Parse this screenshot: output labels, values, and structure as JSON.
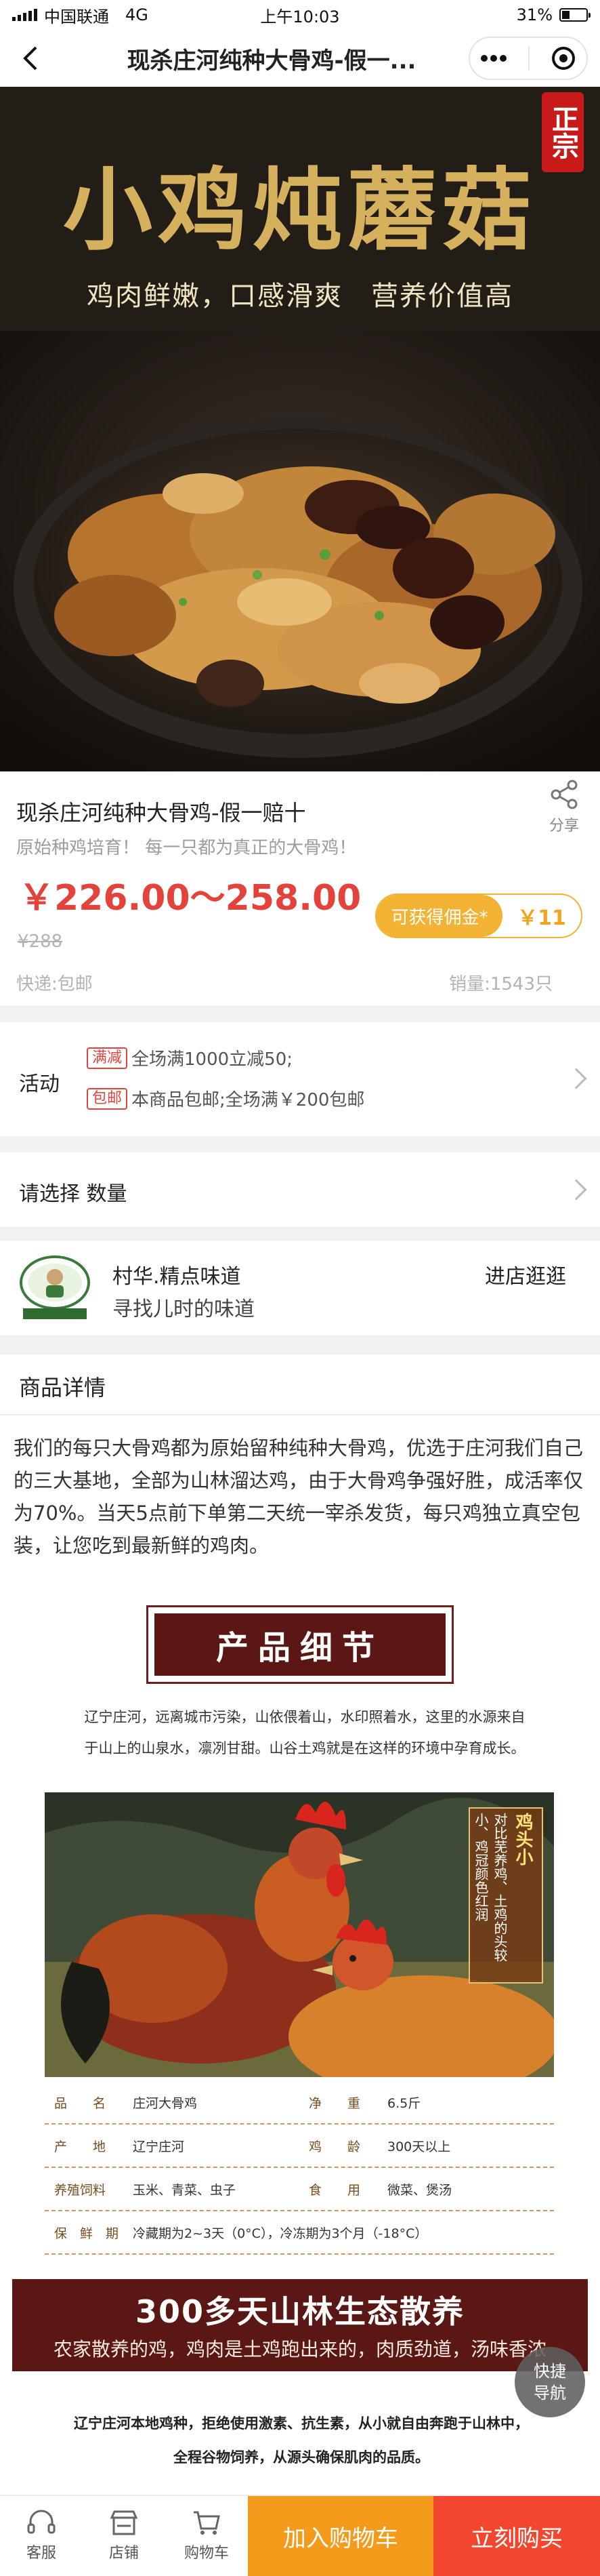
{
  "status_bar": {
    "carrier": "中国联通",
    "network": "4G",
    "time": "上午10:03",
    "battery": "31%",
    "battery_level": 0.31
  },
  "nav": {
    "title": "现杀庄河纯种大骨鸡-假一..."
  },
  "hero": {
    "title": "小鸡炖蘑菇",
    "subtitle": "鸡肉鲜嫩，口感滑爽　营养价值高",
    "badge": "正宗"
  },
  "product": {
    "name": "现杀庄河纯种大骨鸡-假一赔十",
    "share_label": "分享",
    "description": "原始种鸡培育！ 每一只都为真正的大骨鸡！",
    "price_range": "￥226.00～258.00",
    "commission_label": "可获得佣金*",
    "commission_value": "￥11",
    "original_price": "¥288",
    "shipping": "快递:包邮",
    "sales": "销量:1543只"
  },
  "activity": {
    "label": "活动",
    "items": [
      {
        "tag": "满减",
        "text": "全场满1000立减50;"
      },
      {
        "tag": "包邮",
        "text": "本商品包邮;全场满￥200包邮"
      }
    ]
  },
  "select": {
    "label": "请选择 数量"
  },
  "shop": {
    "name": "村华.精点味道",
    "slogan": "寻找儿时的味道",
    "enter_label": "进店逛逛",
    "logo_text": "Real Flavor Rustic"
  },
  "detail": {
    "title": "商品详情",
    "intro": "我们的每只大骨鸡都为原始留种纯种大骨鸡，优选于庄河我们自己的三大基地，全部为山林溜达鸡，由于大骨鸡争强好胜，成活率仅为70%。当天5点前下单第二天统一宰杀发货，每只鸡独立真空包装，让您吃到最新鲜的鸡肉。"
  },
  "poster": {
    "title": "产品细节",
    "text_line1": "辽宁庄河，远离城市污染，山依偎着山，水印照着水，这里的水源来自",
    "text_line2": "于山上的山泉水，凛冽甘甜。山谷土鸡就是在这样的环境中孕育成长。",
    "callout": {
      "head": "鸡头小",
      "col1": "对比芜养鸡、土鸡的头较",
      "col2": "小、鸡冠颜色红润"
    },
    "specs": [
      [
        {
          "k": "品　　名",
          "v": "庄河大骨鸡"
        },
        {
          "k": "净　　重",
          "v": "6.5斤"
        }
      ],
      [
        {
          "k": "产　　地",
          "v": "辽宁庄河"
        },
        {
          "k": "鸡　　龄",
          "v": "300天以上"
        }
      ],
      [
        {
          "k": "养殖饲料",
          "v": "玉米、青菜、虫子"
        },
        {
          "k": "食　　用",
          "v": "微菜、煲汤"
        }
      ],
      [
        {
          "k": "保　鲜　期",
          "v": "冷藏期为2~3天（0°C），冷冻期为3个月（-18°C）"
        }
      ]
    ],
    "eco_heading": "300多天山林生态散养",
    "eco_sub": "农家散养的鸡，鸡肉是土鸡跑出来的，肉质劲道，汤味香浓",
    "farm_line1": "辽宁庄河本地鸡种，拒绝使用激素、抗生素，从小就自由奔跑于山林中，",
    "farm_line2": "全程谷物饲养，从源头确保肌肉的品质。"
  },
  "quick_nav": {
    "label": "快捷导航"
  },
  "bottom_bar": {
    "service": "客服",
    "store": "店铺",
    "cart": "购物车",
    "add_to_cart": "加入购物车",
    "buy_now": "立刻购买"
  },
  "colors": {
    "price": "#e4433c",
    "commission": "#f2b233",
    "cart_button": "#f49b1b",
    "buy_button": "#f2472e",
    "poster_brown": "#5a1714"
  }
}
